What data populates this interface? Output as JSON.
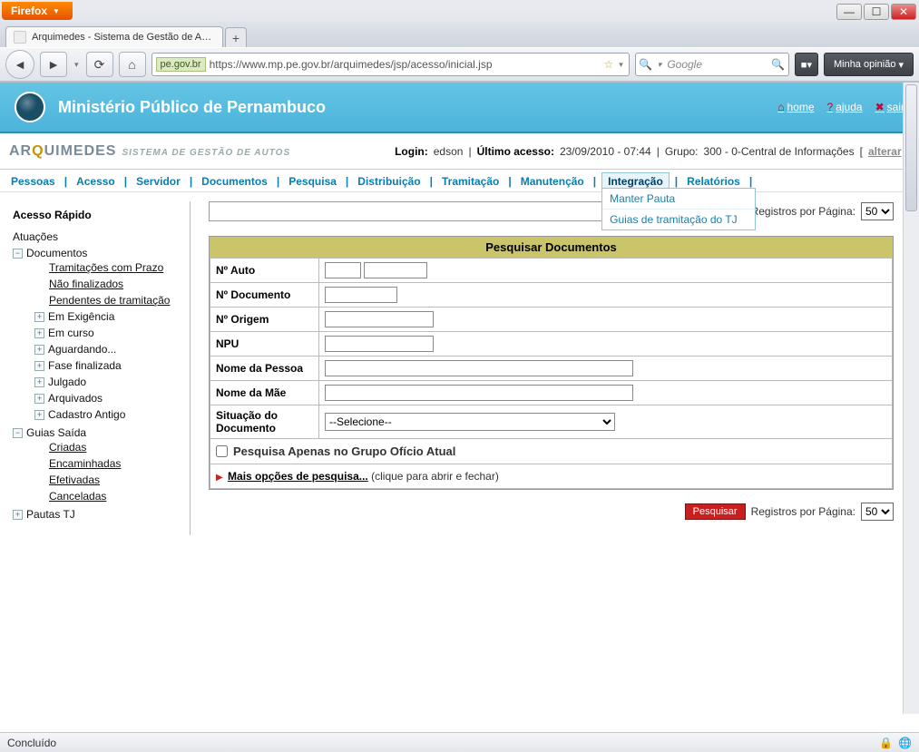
{
  "window": {
    "browser_menu": "Firefox",
    "tab_title": "Arquimedes - Sistema de Gestão de Aut...",
    "url_host": "pe.gov.br",
    "url_full": "https://www.mp.pe.gov.br/arquimedes/jsp/acesso/inicial.jsp",
    "search_placeholder": "Google",
    "opinion_btn": "Minha opinião",
    "status": "Concluído"
  },
  "banner": {
    "org": "Ministério Público de Pernambuco",
    "links": {
      "home": "home",
      "help": "ajuda",
      "exit": "sair"
    }
  },
  "brand": {
    "name_prefix": "AR",
    "name_q": "Q",
    "name_suffix": "UIMEDES",
    "subtitle": "SISTEMA DE GESTÃO DE AUTOS"
  },
  "login": {
    "login_label": "Login:",
    "login_value": "edson",
    "last_label": "Último acesso:",
    "last_value": "23/09/2010 - 07:44",
    "group_label": "Grupo:",
    "group_value": "300 - 0-Central de Informações",
    "change": "alterar"
  },
  "menu": {
    "items": [
      "Pessoas",
      "Acesso",
      "Servidor",
      "Documentos",
      "Pesquisa",
      "Distribuição",
      "Tramitação",
      "Manutenção",
      "Integração",
      "Relatórios"
    ],
    "active_index": 8,
    "dropdown": [
      "Manter Pauta",
      "Guias de tramitação do TJ"
    ]
  },
  "sidebar": {
    "title": "Acesso Rápido",
    "items": [
      {
        "label": "Atuações",
        "type": "leaf"
      },
      {
        "label": "Documentos",
        "type": "open",
        "children": [
          {
            "label": "Tramitações com Prazo",
            "u": true
          },
          {
            "label": "Não finalizados",
            "u": true
          },
          {
            "label": "Pendentes de tramitação",
            "u": true
          },
          {
            "label": "Em Exigência",
            "pm": "+"
          },
          {
            "label": "Em curso",
            "pm": "+"
          },
          {
            "label": "Aguardando...",
            "pm": "+"
          },
          {
            "label": "Fase finalizada",
            "pm": "+"
          },
          {
            "label": "Julgado",
            "pm": "+"
          },
          {
            "label": "Arquivados",
            "pm": "+"
          },
          {
            "label": "Cadastro Antigo",
            "pm": "+"
          }
        ]
      },
      {
        "label": "Guias Saída",
        "type": "open",
        "children": [
          {
            "label": "Criadas",
            "u": true
          },
          {
            "label": "Encaminhadas",
            "u": true
          },
          {
            "label": "Efetivadas",
            "u": true
          },
          {
            "label": "Canceladas",
            "u": true
          }
        ]
      },
      {
        "label": "Pautas TJ",
        "pm": "+"
      }
    ]
  },
  "search_controls": {
    "btn": "Pesquisar",
    "reg_label": "Registros por Página:",
    "reg_value": "50"
  },
  "form": {
    "title": "Pesquisar Documentos",
    "rows": {
      "no_auto": "Nº Auto",
      "no_doc": "Nº Documento",
      "no_origem": "Nº Origem",
      "npu": "NPU",
      "nome_pessoa": "Nome da Pessoa",
      "nome_mae": "Nome da Mãe",
      "situacao": "Situação do Documento",
      "situacao_sel": "--Selecione--"
    },
    "checkbox": "Pesquisa Apenas no Grupo Ofício Atual",
    "more_link": "Mais opções de pesquisa...",
    "more_hint": "(clique para abrir e fechar)"
  }
}
